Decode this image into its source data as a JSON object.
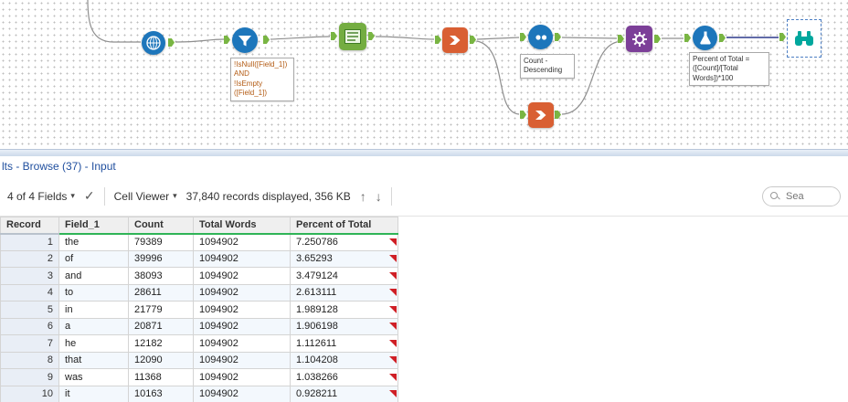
{
  "canvas": {
    "tools": [
      {
        "id": "input-data-tool"
      },
      {
        "id": "filter-tool"
      },
      {
        "id": "text-tool"
      },
      {
        "id": "summarize-tool-1"
      },
      {
        "id": "sort-tool"
      },
      {
        "id": "macro-gear-tool"
      },
      {
        "id": "formula-tool"
      },
      {
        "id": "browse-tool"
      },
      {
        "id": "summarize-tool-2"
      }
    ],
    "annotations": {
      "filter": "!IsNull([Field_1])\nAND\n!IsEmpty\n([Field_1])",
      "sort": "Count -\nDescending",
      "formula": "Percent of Total =\n([Count]/[Total\nWords])*100"
    }
  },
  "results_header": {
    "title": "lts - Browse (37) - Input"
  },
  "toolbar": {
    "fields_selector": "4 of 4 Fields",
    "cell_viewer": "Cell Viewer",
    "records_info": "37,840 records displayed, 356 KB",
    "search_placeholder": "Sea"
  },
  "icons": {
    "dropdown_caret": "▾",
    "check": "✓",
    "up_arrow": "↑",
    "down_arrow": "↓"
  },
  "colors": {
    "tool_blue": "#1d76bb",
    "tool_green": "#74ad41",
    "tool_orange": "#d95f33",
    "tool_purple": "#7c3f98",
    "tool_teal": "#00a79d",
    "header_underline_green": "#2fb457",
    "flag_red": "#cf1f25",
    "link_blue": "#1f4e9e"
  },
  "table": {
    "columns": [
      "Record",
      "Field_1",
      "Count",
      "Total Words",
      "Percent of Total"
    ],
    "rows": [
      [
        "1",
        "the",
        "79389",
        "1094902",
        "7.250786"
      ],
      [
        "2",
        "of",
        "39996",
        "1094902",
        "3.65293"
      ],
      [
        "3",
        "and",
        "38093",
        "1094902",
        "3.479124"
      ],
      [
        "4",
        "to",
        "28611",
        "1094902",
        "2.613111"
      ],
      [
        "5",
        "in",
        "21779",
        "1094902",
        "1.989128"
      ],
      [
        "6",
        "a",
        "20871",
        "1094902",
        "1.906198"
      ],
      [
        "7",
        "he",
        "12182",
        "1094902",
        "1.112611"
      ],
      [
        "8",
        "that",
        "12090",
        "1094902",
        "1.104208"
      ],
      [
        "9",
        "was",
        "11368",
        "1094902",
        "1.038266"
      ],
      [
        "10",
        "it",
        "10163",
        "1094902",
        "0.928211"
      ]
    ]
  }
}
